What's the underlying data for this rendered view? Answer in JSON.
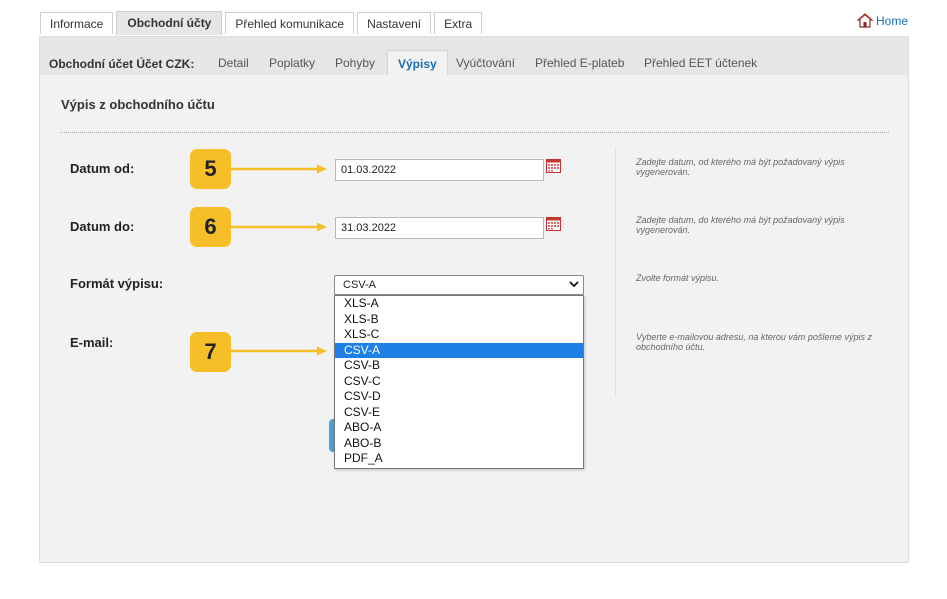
{
  "top_tabs": [
    "Informace",
    "Obchodní účty",
    "Přehled komunikace",
    "Nastavení",
    "Extra"
  ],
  "home_label": "Home",
  "sub_nav": {
    "prefix": "Obchodní účet Účet CZK:",
    "tabs": [
      "Detail",
      "Poplatky",
      "Pohyby",
      "Výpisy",
      "Vyúčtování",
      "Přehled E-plateb",
      "Přehled EET účtenek"
    ]
  },
  "section_title": "Výpis z obchodního účtu",
  "form": {
    "date_from": {
      "label": "Datum od:",
      "value": "01.03.2022",
      "help": "Zadejte datum, od kterého má být požadovaný výpis vygenerován."
    },
    "date_to": {
      "label": "Datum do:",
      "value": "31.03.2022",
      "help": "Zadejte datum, do kterého má být požadovaný výpis vygenerován."
    },
    "format": {
      "label": "Formát výpisu:",
      "selected": "CSV-A",
      "help": "Zvolte formát výpisu.",
      "options": [
        "XLS-A",
        "XLS-B",
        "XLS-C",
        "CSV-A",
        "CSV-B",
        "CSV-C",
        "CSV-D",
        "CSV-E",
        "ABO-A",
        "ABO-B",
        "PDF_A"
      ]
    },
    "email": {
      "label": "E-mail:",
      "help": "Vyberte e-mailovou adresu, na kterou vám pošleme výpis z obchodního účtu."
    }
  },
  "badges": [
    "5",
    "6",
    "7"
  ],
  "colors": {
    "badge": "#f6be27",
    "accent": "#1a6fb5",
    "selected_option": "#1e7fe6"
  }
}
